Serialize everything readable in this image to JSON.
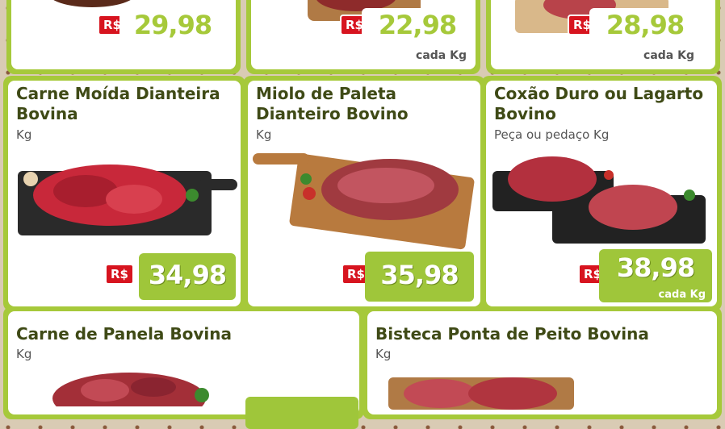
{
  "top_row": [
    {
      "rs": "R$",
      "price": "29,98",
      "sub": ""
    },
    {
      "rs": "R$",
      "price": "22,98",
      "sub": "cada Kg"
    },
    {
      "rs": "R$",
      "price": "28,98",
      "sub": "cada Kg"
    }
  ],
  "middle_row": [
    {
      "title": "Carne Moída Dianteira Bovina",
      "unit": "Kg",
      "rs": "R$",
      "price": "34,98",
      "sub": ""
    },
    {
      "title": "Miolo de Paleta Dianteiro Bovino",
      "unit": "Kg",
      "rs": "R$",
      "price": "35,98",
      "sub": ""
    },
    {
      "title": "Coxão Duro ou Lagarto Bovino",
      "unit": "Peça ou pedaço Kg",
      "rs": "R$",
      "price": "38,98",
      "sub": "cada Kg"
    }
  ],
  "bottom_row": [
    {
      "title": "Carne de Panela Bovina",
      "unit": "Kg"
    },
    {
      "title": "Bisteca Ponta de Peito Bovina",
      "unit": "Kg"
    }
  ],
  "colors": {
    "accent_green": "#a6c93a",
    "price_red": "#d7141f",
    "title_text": "#3f4a16"
  }
}
